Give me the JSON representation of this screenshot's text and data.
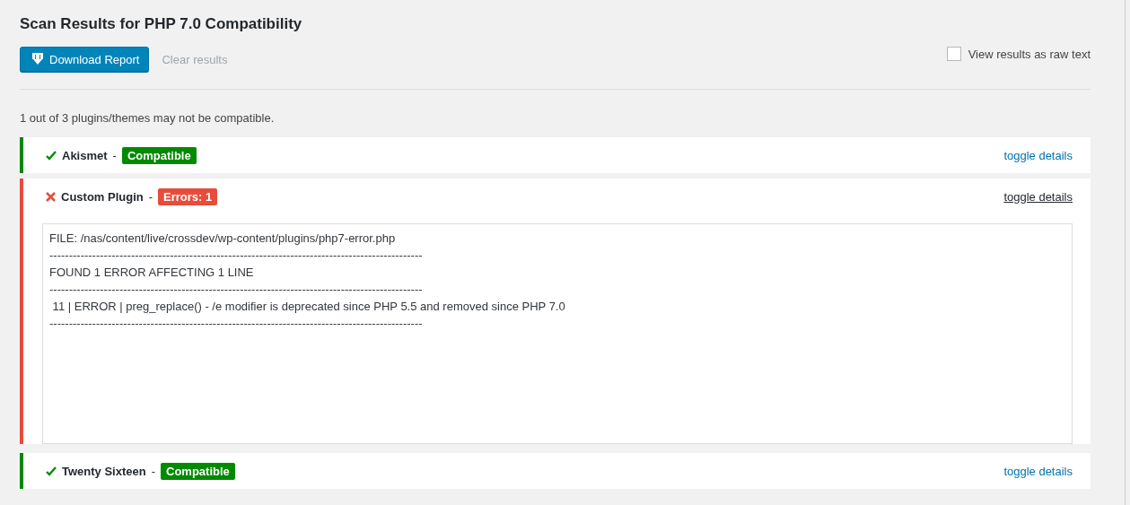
{
  "title": "Scan Results for PHP 7.0 Compatibility",
  "toolbar": {
    "download_button": "Download Report",
    "clear_link": "Clear results",
    "raw_text_checkbox": {
      "label": "View results as raw text",
      "checked": false
    }
  },
  "summary": "1 out of 3 plugins/themes may not be compatible.",
  "results": [
    {
      "name": "Akismet",
      "separator": "-",
      "kind": "compatible",
      "badge": "Compatible",
      "toggle": "toggle details",
      "expanded": false
    },
    {
      "name": "Custom Plugin",
      "separator": "-",
      "kind": "error",
      "badge": "Errors: 1",
      "toggle": "toggle details",
      "expanded": true,
      "details": [
        "FILE: /nas/content/live/crossdev/wp-content/plugins/php7-error.php",
        "------------------------------------------------------------------------------------------------",
        "FOUND 1 ERROR AFFECTING 1 LINE",
        "------------------------------------------------------------------------------------------------",
        " 11 | ERROR | preg_replace() - /e modifier is deprecated since PHP 5.5 and removed since PHP 7.0",
        "------------------------------------------------------------------------------------------------"
      ]
    },
    {
      "name": "Twenty Sixteen",
      "separator": "-",
      "kind": "compatible",
      "badge": "Compatible",
      "toggle": "toggle details",
      "expanded": false
    }
  ]
}
